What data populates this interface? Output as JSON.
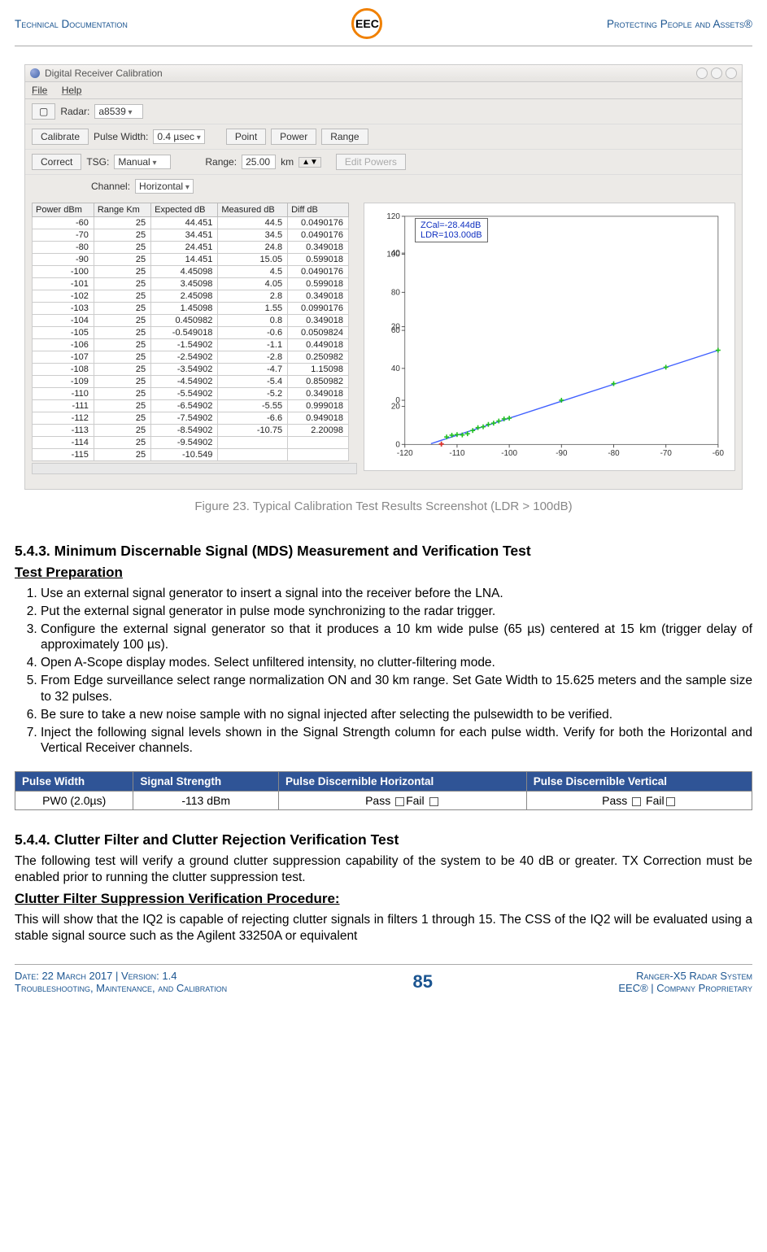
{
  "header": {
    "left": "Technical Documentation",
    "right": "Protecting People and Assets®",
    "logo_text": "EEC"
  },
  "screenshot": {
    "title": "Digital Receiver Calibration",
    "menu": [
      "File",
      "Help"
    ],
    "toolbar1": {
      "radar_label": "Radar:",
      "radar_value": "a8539"
    },
    "toolbar2": {
      "calibrate": "Calibrate",
      "pw_label": "Pulse Width:",
      "pw_value": "0.4 µsec",
      "tabs": [
        "Point",
        "Power",
        "Range"
      ]
    },
    "toolbar3": {
      "correct": "Correct",
      "tsg_label": "TSG:",
      "tsg_value": "Manual",
      "range_label": "Range:",
      "range_value": "25.00",
      "range_unit": "km",
      "edit_powers": "Edit Powers"
    },
    "toolbar4": {
      "channel_label": "Channel:",
      "channel_value": "Horizontal"
    },
    "table_headers": [
      "Power dBm",
      "Range Km",
      "Expected dB",
      "Measured dB",
      "Diff dB"
    ],
    "legend": {
      "l1": "ZCal=-28.44dB",
      "l2": "LDR=103.00dB"
    }
  },
  "chart_data": {
    "type": "scatter",
    "xlabel": "",
    "ylabel": "",
    "xlim": [
      -120,
      -60
    ],
    "ylim": [
      -12,
      50
    ],
    "xticks": [
      -120,
      -110,
      -100,
      -90,
      -80,
      -70,
      -60
    ],
    "yticks": [
      0,
      20,
      40,
      60,
      80,
      100,
      120
    ],
    "series": [
      {
        "name": "Expected dB",
        "color": "#4060ff",
        "style": "line",
        "x": [
          -115,
          -114,
          -113,
          -112,
          -111,
          -110,
          -109,
          -108,
          -107,
          -106,
          -105,
          -104,
          -103,
          -102,
          -101,
          -100,
          -90,
          -80,
          -70,
          -60
        ],
        "y": [
          -10.549,
          -9.549,
          -8.549,
          -7.549,
          -6.549,
          -5.549,
          -4.549,
          -3.549,
          -2.549,
          -1.549,
          -0.549,
          0.451,
          1.451,
          2.451,
          3.451,
          4.451,
          14.451,
          24.451,
          34.451,
          44.451
        ]
      },
      {
        "name": "Measured dB",
        "color": "#20d020",
        "style": "points",
        "x": [
          -113,
          -112,
          -111,
          -110,
          -109,
          -108,
          -107,
          -106,
          -105,
          -104,
          -103,
          -102,
          -101,
          -100,
          -90,
          -80,
          -70,
          -60
        ],
        "y": [
          -10.75,
          -6.6,
          -5.55,
          -5.2,
          -5.4,
          -4.7,
          -2.8,
          -1.1,
          -0.6,
          0.8,
          1.55,
          2.8,
          4.05,
          4.5,
          15.05,
          24.8,
          34.5,
          44.5
        ]
      }
    ],
    "table_rows": [
      {
        "p": -60,
        "r": 25,
        "e": 44.451,
        "m": 44.5,
        "d": 0.0490176
      },
      {
        "p": -70,
        "r": 25,
        "e": 34.451,
        "m": 34.5,
        "d": 0.0490176
      },
      {
        "p": -80,
        "r": 25,
        "e": 24.451,
        "m": 24.8,
        "d": 0.349018
      },
      {
        "p": -90,
        "r": 25,
        "e": 14.451,
        "m": 15.05,
        "d": 0.599018
      },
      {
        "p": -100,
        "r": 25,
        "e": 4.45098,
        "m": 4.5,
        "d": 0.0490176
      },
      {
        "p": -101,
        "r": 25,
        "e": 3.45098,
        "m": 4.05,
        "d": 0.599018
      },
      {
        "p": -102,
        "r": 25,
        "e": 2.45098,
        "m": 2.8,
        "d": 0.349018
      },
      {
        "p": -103,
        "r": 25,
        "e": 1.45098,
        "m": 1.55,
        "d": 0.0990176
      },
      {
        "p": -104,
        "r": 25,
        "e": 0.450982,
        "m": 0.8,
        "d": 0.349018
      },
      {
        "p": -105,
        "r": 25,
        "e": -0.549018,
        "m": -0.6,
        "d": 0.0509824
      },
      {
        "p": -106,
        "r": 25,
        "e": -1.54902,
        "m": -1.1,
        "d": 0.449018
      },
      {
        "p": -107,
        "r": 25,
        "e": -2.54902,
        "m": -2.8,
        "d": 0.250982
      },
      {
        "p": -108,
        "r": 25,
        "e": -3.54902,
        "m": -4.7,
        "d": 1.15098
      },
      {
        "p": -109,
        "r": 25,
        "e": -4.54902,
        "m": -5.4,
        "d": 0.850982
      },
      {
        "p": -110,
        "r": 25,
        "e": -5.54902,
        "m": -5.2,
        "d": 0.349018
      },
      {
        "p": -111,
        "r": 25,
        "e": -6.54902,
        "m": -5.55,
        "d": 0.999018
      },
      {
        "p": -112,
        "r": 25,
        "e": -7.54902,
        "m": -6.6,
        "d": 0.949018
      },
      {
        "p": -113,
        "r": 25,
        "e": -8.54902,
        "m": -10.75,
        "d": 2.20098
      },
      {
        "p": -114,
        "r": 25,
        "e": -9.54902,
        "m": "",
        "d": ""
      },
      {
        "p": -115,
        "r": 25,
        "e": -10.549,
        "m": "",
        "d": ""
      }
    ]
  },
  "caption": "Figure 23. Typical Calibration Test Results Screenshot (LDR > 100dB)",
  "sections": {
    "s543_head": "5.4.3.   Minimum Discernable Signal (MDS) Measurement and Verification Test",
    "prep_head": "Test Preparation",
    "prep_items": [
      "Use an external signal generator to insert a signal into the receiver before the LNA.",
      "Put the external signal generator in pulse mode synchronizing to the radar trigger.",
      "Configure the external signal generator so that it produces a 10 km wide pulse (65 µs) centered at 15 km (trigger delay of approximately 100 µs).",
      "Open A-Scope display modes.  Select unfiltered intensity, no clutter-filtering mode.",
      "From Edge surveillance select range normalization ON and 30 km range.  Set Gate Width to 15.625 meters and the sample size to 32 pulses.",
      "Be sure to take a new noise sample with no signal injected after selecting the pulsewidth to be verified.",
      "Inject the following signal levels shown in the Signal Strength column for each pulse width.  Verify for both the Horizontal and Vertical Receiver channels."
    ],
    "mds_headers": [
      "Pulse Width",
      "Signal Strength",
      "Pulse Discernible Horizontal",
      "Pulse Discernible Vertical"
    ],
    "mds_row": {
      "pw": "PW0 (2.0µs)",
      "ss": "-113 dBm",
      "pass": "Pass",
      "fail": "Fail"
    },
    "s544_head": "5.4.4.   Clutter Filter and Clutter Rejection Verification Test",
    "s544_p1": "The following test will verify a ground clutter suppression capability of the system to be 40 dB or greater.  TX Correction must be enabled prior to running the clutter suppression test.",
    "s544_sub": "Clutter Filter Suppression Verification Procedure:",
    "s544_p2": "This will show that the IQ2 is capable of rejecting clutter signals in filters 1 through 15.  The CSS of the IQ2 will be evaluated using a stable signal source such as the Agilent 33250A or equivalent"
  },
  "footer": {
    "left1": "Date: 22 March 2017 | Version: 1.4",
    "left2": "Troubleshooting, Maintenance, and Calibration",
    "page": "85",
    "right1": "Ranger-X5 Radar System",
    "right2": "EEC® | Company Proprietary"
  }
}
